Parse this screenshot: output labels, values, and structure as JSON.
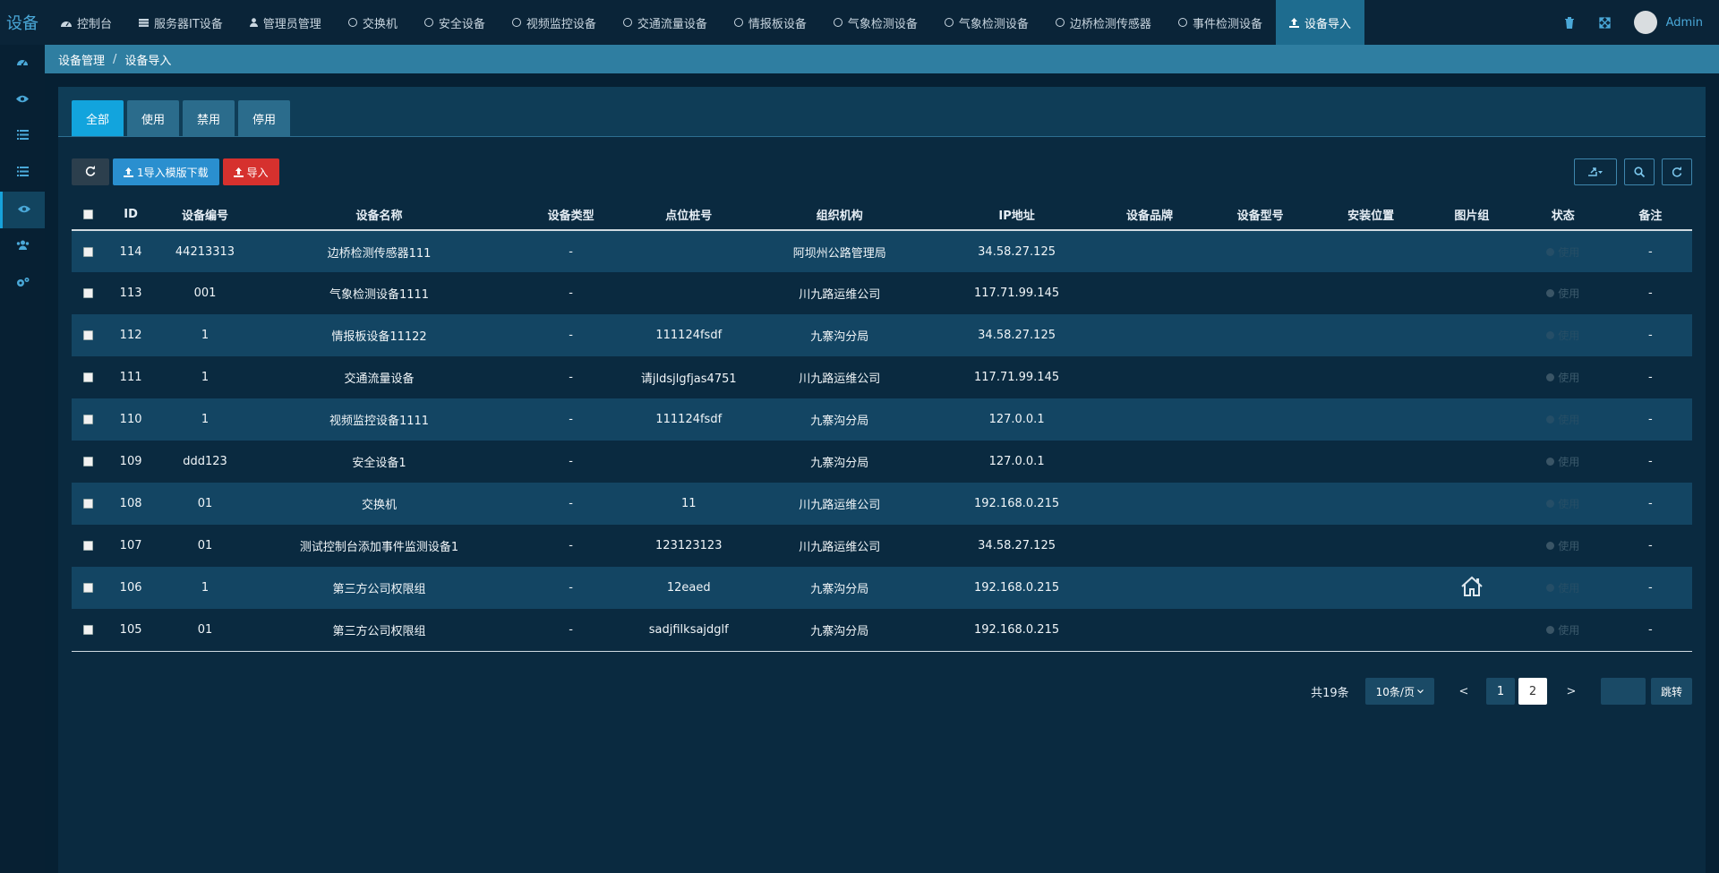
{
  "brand": "设备",
  "nav": {
    "tabs": [
      {
        "label": "控制台",
        "icon": "dashboard-icon"
      },
      {
        "label": "服务器IT设备",
        "icon": "server-icon"
      },
      {
        "label": "管理员管理",
        "icon": "user-icon"
      },
      {
        "label": "交换机",
        "icon": "circle-icon"
      },
      {
        "label": "安全设备",
        "icon": "circle-icon"
      },
      {
        "label": "视频监控设备",
        "icon": "circle-icon"
      },
      {
        "label": "交通流量设备",
        "icon": "circle-icon"
      },
      {
        "label": "情报板设备",
        "icon": "circle-icon"
      },
      {
        "label": "气象检测设备",
        "icon": "circle-icon"
      },
      {
        "label": "气象检测设备",
        "icon": "circle-icon"
      },
      {
        "label": "边桥检测传感器",
        "icon": "circle-icon"
      },
      {
        "label": "事件检测设备",
        "icon": "circle-icon"
      },
      {
        "label": "设备导入",
        "icon": "upload-icon",
        "active": true
      }
    ],
    "user": "Admin"
  },
  "breadcrumb": {
    "parent": "设备管理",
    "separator": "/",
    "current": "设备导入"
  },
  "filter_tabs": [
    {
      "label": "全部",
      "active": true
    },
    {
      "label": "使用"
    },
    {
      "label": "禁用"
    },
    {
      "label": "停用"
    }
  ],
  "toolbar": {
    "template_label": "1导入模版下载",
    "import_label": "导入"
  },
  "table": {
    "columns": [
      "ID",
      "设备编号",
      "设备名称",
      "设备类型",
      "点位桩号",
      "组织机构",
      "IP地址",
      "设备品牌",
      "设备型号",
      "安装位置",
      "图片组",
      "状态",
      "备注"
    ],
    "rows": [
      {
        "id": "114",
        "code": "44213313",
        "name": "边桥检测传感器111",
        "type": "-",
        "pile": "",
        "org": "阿坝州公路管理局",
        "ip": "34.58.27.125",
        "brand": "",
        "model": "",
        "loc": "",
        "img": "",
        "status": "使用",
        "note": "-"
      },
      {
        "id": "113",
        "code": "001",
        "name": "气象检测设备1111",
        "type": "-",
        "pile": "",
        "org": "川九路运维公司",
        "ip": "117.71.99.145",
        "brand": "",
        "model": "",
        "loc": "",
        "img": "",
        "status": "使用",
        "note": "-"
      },
      {
        "id": "112",
        "code": "1",
        "name": "情报板设备11122",
        "type": "-",
        "pile": "111124fsdf",
        "org": "九寨沟分局",
        "ip": "34.58.27.125",
        "brand": "",
        "model": "",
        "loc": "",
        "img": "",
        "status": "使用",
        "note": "-"
      },
      {
        "id": "111",
        "code": "1",
        "name": "交通流量设备",
        "type": "-",
        "pile": "请jldsjlgfjas4751",
        "org": "川九路运维公司",
        "ip": "117.71.99.145",
        "brand": "",
        "model": "",
        "loc": "",
        "img": "",
        "status": "使用",
        "note": "-"
      },
      {
        "id": "110",
        "code": "1",
        "name": "视频监控设备1111",
        "type": "-",
        "pile": "111124fsdf",
        "org": "九寨沟分局",
        "ip": "127.0.0.1",
        "brand": "",
        "model": "",
        "loc": "",
        "img": "",
        "status": "使用",
        "note": "-"
      },
      {
        "id": "109",
        "code": "ddd123",
        "name": "安全设备1",
        "type": "-",
        "pile": "",
        "org": "九寨沟分局",
        "ip": "127.0.0.1",
        "brand": "",
        "model": "",
        "loc": "",
        "img": "",
        "status": "使用",
        "note": "-"
      },
      {
        "id": "108",
        "code": "01",
        "name": "交换机",
        "type": "-",
        "pile": "11",
        "org": "川九路运维公司",
        "ip": "192.168.0.215",
        "brand": "",
        "model": "",
        "loc": "",
        "img": "",
        "status": "使用",
        "note": "-"
      },
      {
        "id": "107",
        "code": "01",
        "name": "测试控制台添加事件监测设备1",
        "type": "-",
        "pile": "123123123",
        "org": "川九路运维公司",
        "ip": "34.58.27.125",
        "brand": "",
        "model": "",
        "loc": "",
        "img": "",
        "status": "使用",
        "note": "-"
      },
      {
        "id": "106",
        "code": "1",
        "name": "第三方公司权限组",
        "type": "-",
        "pile": "12eaed",
        "org": "九寨沟分局",
        "ip": "192.168.0.215",
        "brand": "",
        "model": "",
        "loc": "",
        "img": "house-icon",
        "status": "使用",
        "note": "-"
      },
      {
        "id": "105",
        "code": "01",
        "name": "第三方公司权限组",
        "type": "-",
        "pile": "sadjfilksajdglf",
        "org": "九寨沟分局",
        "ip": "192.168.0.215",
        "brand": "",
        "model": "",
        "loc": "",
        "img": "",
        "status": "使用",
        "note": "-"
      }
    ]
  },
  "pager": {
    "total": "共19条",
    "page_size": "10条/页",
    "prev": "<",
    "next": ">",
    "pages": [
      "1",
      "2"
    ],
    "current": "2",
    "jump_label": "跳转"
  },
  "colors": {
    "accent": "#12a4dd",
    "danger": "#d6312e",
    "bg": "#062033",
    "row_alt": "#134563"
  }
}
